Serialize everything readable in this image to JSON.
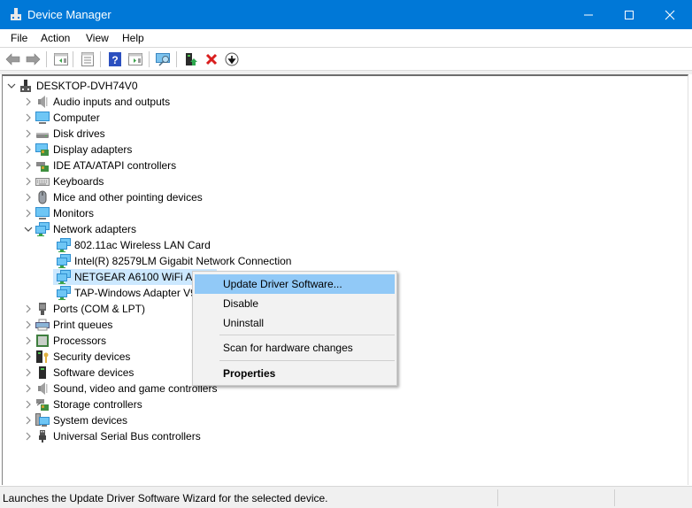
{
  "window": {
    "title": "Device Manager",
    "accent_color": "#0078d7"
  },
  "menu": {
    "items": [
      "File",
      "Action",
      "View",
      "Help"
    ]
  },
  "toolbar": {
    "buttons": [
      {
        "icon": "back-arrow-icon"
      },
      {
        "icon": "forward-arrow-icon"
      },
      {
        "icon": "show-hide-console-tree-icon"
      },
      {
        "icon": "properties-icon"
      },
      {
        "icon": "help-icon"
      },
      {
        "icon": "show-action-pane-icon"
      },
      {
        "icon": "scan-hardware-icon"
      },
      {
        "icon": "update-driver-icon"
      },
      {
        "icon": "uninstall-device-icon"
      },
      {
        "icon": "disable-device-icon"
      }
    ]
  },
  "tree": {
    "root": {
      "label": "DESKTOP-DVH74V0",
      "expanded": true
    },
    "categories": [
      {
        "label": "Audio inputs and outputs",
        "icon": "speaker-icon",
        "expanded": false
      },
      {
        "label": "Computer",
        "icon": "monitor-icon",
        "expanded": false
      },
      {
        "label": "Disk drives",
        "icon": "disk-drive-icon",
        "expanded": false
      },
      {
        "label": "Display adapters",
        "icon": "display-adapter-icon",
        "expanded": false
      },
      {
        "label": "IDE ATA/ATAPI controllers",
        "icon": "ide-controller-icon",
        "expanded": false
      },
      {
        "label": "Keyboards",
        "icon": "keyboard-icon",
        "expanded": false
      },
      {
        "label": "Mice and other pointing devices",
        "icon": "mouse-icon",
        "expanded": false
      },
      {
        "label": "Monitors",
        "icon": "monitor-icon",
        "expanded": false
      },
      {
        "label": "Network adapters",
        "icon": "network-adapter-icon",
        "expanded": true,
        "children": [
          {
            "label": "802.11ac Wireless LAN Card",
            "icon": "network-adapter-icon"
          },
          {
            "label": "Intel(R) 82579LM Gigabit Network Connection",
            "icon": "network-adapter-icon"
          },
          {
            "label": "NETGEAR A6100 WiFi Adapter",
            "icon": "network-adapter-icon",
            "selected": true
          },
          {
            "label": "TAP-Windows Adapter V9",
            "icon": "network-adapter-icon"
          }
        ]
      },
      {
        "label": "Ports (COM & LPT)",
        "icon": "port-icon",
        "expanded": false
      },
      {
        "label": "Print queues",
        "icon": "printer-icon",
        "expanded": false
      },
      {
        "label": "Processors",
        "icon": "processor-icon",
        "expanded": false
      },
      {
        "label": "Security devices",
        "icon": "security-device-icon",
        "expanded": false
      },
      {
        "label": "Software devices",
        "icon": "software-device-icon",
        "expanded": false
      },
      {
        "label": "Sound, video and game controllers",
        "icon": "speaker-icon",
        "expanded": false
      },
      {
        "label": "Storage controllers",
        "icon": "storage-controller-icon",
        "expanded": false
      },
      {
        "label": "System devices",
        "icon": "system-device-icon",
        "expanded": false
      },
      {
        "label": "Universal Serial Bus controllers",
        "icon": "usb-icon",
        "expanded": false
      }
    ]
  },
  "context_menu": {
    "items": [
      {
        "label": "Update Driver Software...",
        "highlighted": true
      },
      {
        "label": "Disable"
      },
      {
        "label": "Uninstall"
      },
      {
        "separator": true
      },
      {
        "label": "Scan for hardware changes"
      },
      {
        "separator": true
      },
      {
        "label": "Properties",
        "bold": true
      }
    ],
    "highlight_color": "#91c9f7"
  },
  "statusbar": {
    "text": "Launches the Update Driver Software Wizard for the selected device."
  }
}
